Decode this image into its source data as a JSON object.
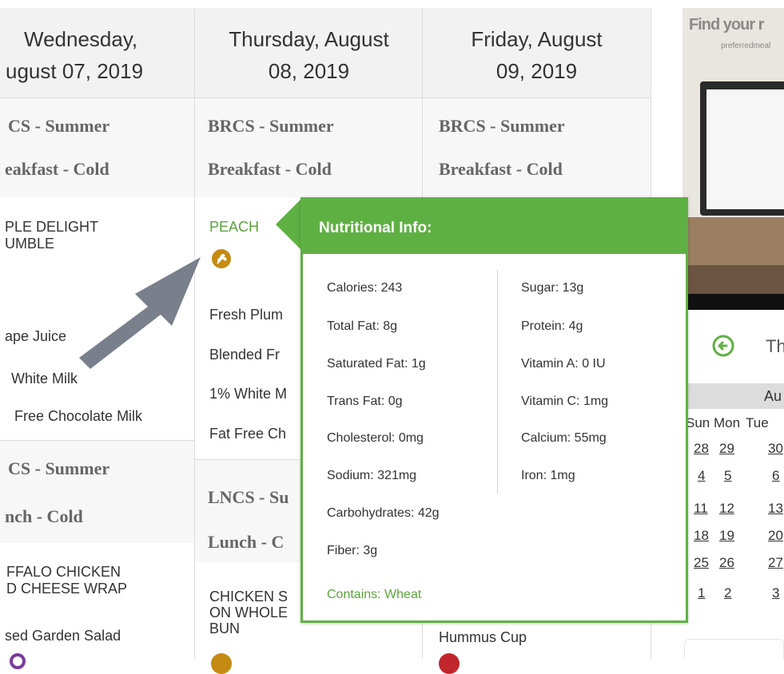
{
  "days": [
    {
      "heading": "Wednesday, August 07, 2019"
    },
    {
      "heading": "Thursday, August 08, 2019"
    },
    {
      "heading": "Friday, August 09, 2019"
    }
  ],
  "wed": {
    "heading_line1": "Wednesday,",
    "heading_line2": "ugust 07, 2019",
    "svc1_line1": "CS - Summer",
    "svc1_line2": "eakfast - Cold",
    "item_main_line1": "PLE DELIGHT",
    "item_main_line2": "UMBLE",
    "items": [
      "ape Juice",
      "White Milk",
      "Free Chocolate Milk"
    ],
    "svc2_line1": "CS - Summer",
    "svc2_line2": "nch - Cold",
    "lunch_main_line1": "FFALO CHICKEN",
    "lunch_main_line2": "D CHEESE WRAP",
    "lunch_side": "sed Garden Salad"
  },
  "thu": {
    "heading_line1": "Thursday, August",
    "heading_line2": "08, 2019",
    "svc1_line1": "BRCS - Summer",
    "svc1_line2": "Breakfast - Cold",
    "item_main": "PEACH",
    "items": [
      "Fresh Plum",
      "Blended Fr",
      "1% White M",
      "Fat Free Ch"
    ],
    "svc2_line1": "LNCS - Su",
    "svc2_line2": "Lunch - C",
    "lunch_main_line1": "CHICKEN S",
    "lunch_main_line2": "ON WHOLE",
    "lunch_main_line3": "BUN"
  },
  "fri": {
    "heading_line1": "Friday, August",
    "heading_line2": "09, 2019",
    "svc1_line1": "BRCS - Summer",
    "svc1_line2": "Breakfast - Cold",
    "lunch_side": "Hummus Cup"
  },
  "tooltip": {
    "title": "Nutritional Info:",
    "left": [
      "Calories: 243",
      "Total Fat: 8g",
      "Saturated Fat: 1g",
      "Trans Fat: 0g",
      "Cholesterol: 0mg",
      "Sodium: 321mg",
      "Carbohydrates: 42g",
      "Fiber: 3g"
    ],
    "right": [
      "Sugar: 13g",
      "Protein: 4g",
      "Vitamin A: 0 IU",
      "Vitamin C: 1mg",
      "Calcium: 55mg",
      "Iron: 1mg"
    ],
    "contains": "Contains: Wheat"
  },
  "ad": {
    "line1": "Find your r",
    "line2": "preferredmeal"
  },
  "calendar": {
    "nav_title": "Th",
    "month_label": "Au",
    "weekdays": [
      "Sun",
      "Mon",
      "Tue"
    ],
    "rows": [
      [
        "28",
        "29",
        "30"
      ],
      [
        "4",
        "5",
        "6"
      ],
      [
        "11",
        "12",
        "13"
      ],
      [
        "18",
        "19",
        "20"
      ],
      [
        "25",
        "26",
        "27"
      ],
      [
        "1",
        "2",
        "3"
      ]
    ]
  },
  "colors": {
    "accent_green": "#5fb043",
    "arrow_gray": "#7a7f8c",
    "header_bg": "#f2f2f2"
  },
  "icons": [
    "wheat-allergen-icon",
    "back-arrow-icon",
    "pointer-arrow-annotation"
  ]
}
